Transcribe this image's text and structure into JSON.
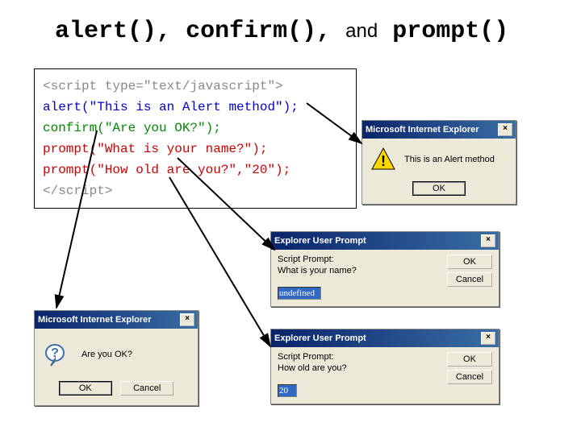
{
  "title": {
    "t1": "alert()",
    "c1": ",",
    "t2": "confirm()",
    "c2": ",",
    "and": "and",
    "t3": "prompt()"
  },
  "code": {
    "l1": "<script type=\"text/javascript\">",
    "l2": "alert(\"This is an Alert method\");",
    "l3": "confirm(\"Are you OK?\");",
    "l4": "prompt(\"What is your name?\");",
    "l5": "prompt(\"How old are you?\",\"20\");",
    "l6": "</script>"
  },
  "alert_dialog": {
    "title": "Microsoft Internet Explorer",
    "message": "This is an Alert method",
    "ok": "OK"
  },
  "confirm_dialog": {
    "title": "Microsoft Internet Explorer",
    "message": "Are you OK?",
    "ok": "OK",
    "cancel": "Cancel"
  },
  "prompt1": {
    "title": "Explorer User Prompt",
    "label": "Script Prompt:",
    "question": "What is your name?",
    "value": "undefined",
    "ok": "OK",
    "cancel": "Cancel"
  },
  "prompt2": {
    "title": "Explorer User Prompt",
    "label": "Script Prompt:",
    "question": "How old are you?",
    "value": "20",
    "ok": "OK",
    "cancel": "Cancel"
  }
}
